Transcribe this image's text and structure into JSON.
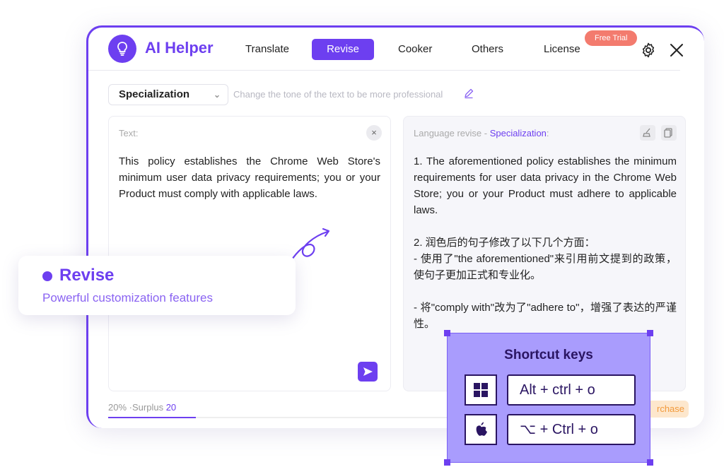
{
  "app": {
    "title": "AI Helper"
  },
  "nav": {
    "tabs": [
      {
        "label": "Translate"
      },
      {
        "label": "Revise",
        "active": true
      },
      {
        "label": "Cooker"
      },
      {
        "label": "Others"
      },
      {
        "label": "License"
      }
    ],
    "trial_badge": "Free Trial"
  },
  "toolbar": {
    "mode_select": "Specialization",
    "tone_hint": "Change the tone of the text to be more professional"
  },
  "input_panel": {
    "label": "Text:",
    "clear_icon": "×",
    "text": "This policy establishes the Chrome Web Store's minimum user data privacy requirements; you or your Product must comply with applicable laws."
  },
  "output_panel": {
    "label_prefix": "Language revise - ",
    "label_mode": "Specialization",
    "label_suffix": ":",
    "lines": [
      "1. The aforementioned policy establishes the minimum requirements for user data privacy in the Chrome Web Store; you or your Product must adhere to applicable laws.",
      "2. 润色后的句子修改了以下几个方面：",
      "- 使用了\"the aforementioned\"来引用前文提到的政策，使句子更加正式和专业化。",
      "- 将\"comply with\"改为了\"adhere to\"，增强了表达的严谨性。"
    ]
  },
  "footer": {
    "percent": "20%",
    "surplus_label": "·Surplus",
    "surplus_value": "20",
    "purchase_label": "rchase",
    "progress": 0.2
  },
  "callout": {
    "title": "Revise",
    "subtitle": "Powerful customization features"
  },
  "shortcuts": {
    "title": "Shortcut keys",
    "windows_keys": "Alt + ctrl + o",
    "mac_keys": "⌥ + Ctrl + o"
  },
  "colors": {
    "brand": "#6d3ff0",
    "trial": "#f37b6e",
    "shortcut_bg": "#a99cfd",
    "purchase_bg": "#fde7cd"
  }
}
